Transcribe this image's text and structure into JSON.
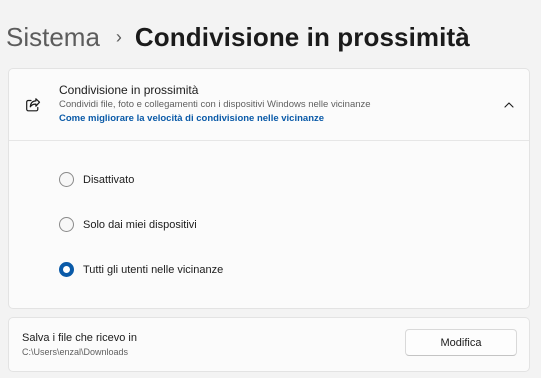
{
  "breadcrumb": {
    "parent": "Sistema",
    "separator": "›",
    "current": "Condivisione in prossimità"
  },
  "nearby_sharing": {
    "title": "Condivisione in prossimità",
    "description": "Condividi file, foto e collegamenti con i dispositivi Windows nelle vicinanze",
    "link": "Come migliorare la velocità di condivisione nelle vicinanze",
    "icon": "share-icon",
    "expanded": true,
    "options": [
      {
        "label": "Disattivato",
        "selected": false
      },
      {
        "label": "Solo dai miei dispositivi",
        "selected": false
      },
      {
        "label": "Tutti gli utenti nelle vicinanze",
        "selected": true
      }
    ]
  },
  "save_location": {
    "title": "Salva i file che ricevo in",
    "path": "C:\\Users\\enzal\\Downloads",
    "button_label": "Modifica"
  },
  "colors": {
    "accent": "#0a5aa8",
    "background": "#f3f3f3",
    "card": "#fbfbfb"
  }
}
